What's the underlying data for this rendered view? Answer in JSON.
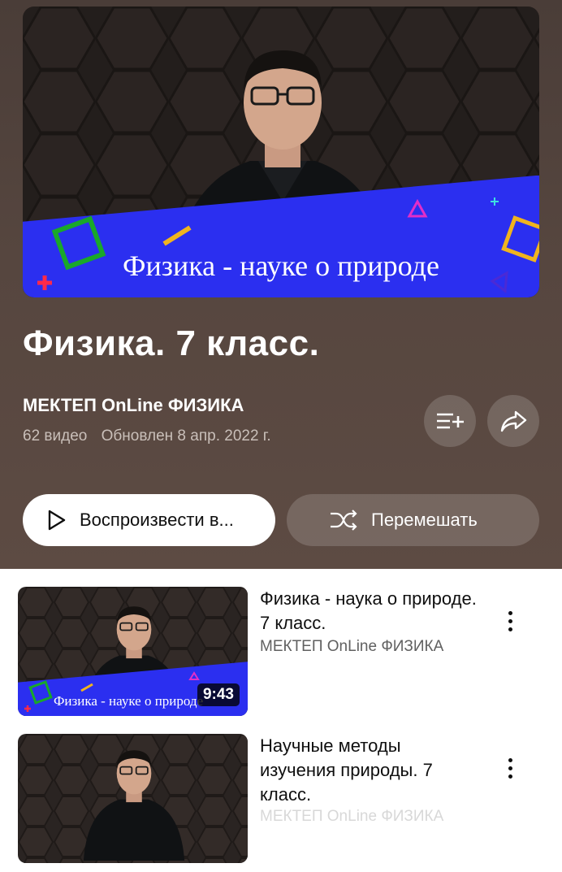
{
  "playlist": {
    "title": "Физика. 7 класс.",
    "channel": "МЕКТЕП OnLine ФИЗИКА",
    "video_count": "62 видео",
    "updated": "Обновлен 8 апр. 2022 г.",
    "thumbnail_caption": "Физика - науке о природе"
  },
  "actions": {
    "add_to_queue_icon": "playlist-add-icon",
    "share_icon": "share-icon",
    "play_all_label": "Воспроизвести в...",
    "shuffle_label": "Перемешать"
  },
  "videos": [
    {
      "title": "Физика - наука о природе. 7 класс.",
      "channel": "МЕКТЕП OnLine ФИЗИКА",
      "duration": "9:43",
      "thumbnail_caption": "Физика - науке о природе"
    },
    {
      "title": "Научные методы изучения природы. 7 класс.",
      "channel": "МЕКТЕП OnLine ФИЗИКА",
      "duration": "",
      "thumbnail_caption": ""
    }
  ],
  "colors": {
    "header_bg": "#56463f",
    "banner_blue": "#2b2ff0",
    "accent_green": "#19a82a",
    "accent_yellow": "#f0b41e"
  }
}
